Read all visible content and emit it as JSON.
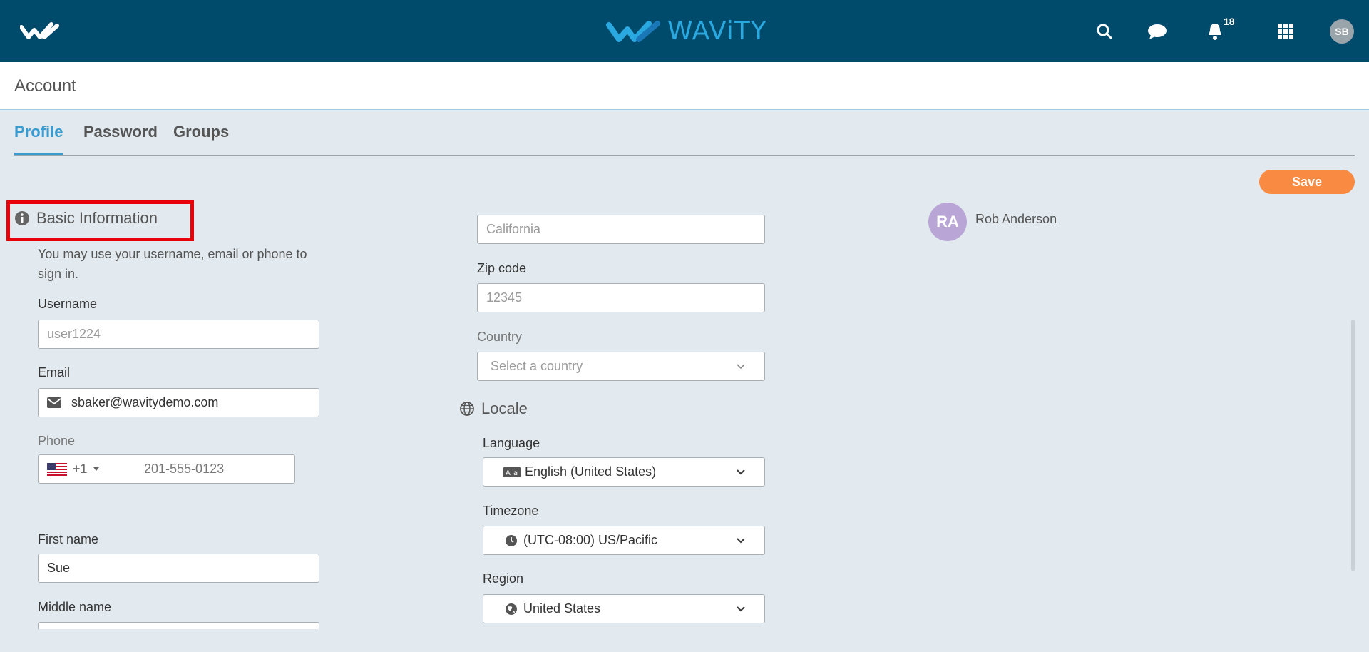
{
  "app": {
    "brand": "WAViTY",
    "notification_count": "18",
    "user_initials": "SB"
  },
  "header": {
    "title": "Account"
  },
  "tabs": [
    {
      "label": "Profile",
      "active": true
    },
    {
      "label": "Password",
      "active": false
    },
    {
      "label": "Groups",
      "active": false
    }
  ],
  "actions": {
    "save_label": "Save"
  },
  "basic_info": {
    "title": "Basic Information",
    "help": "You may use your username, email or phone to sign in.",
    "username_label": "Username",
    "username_placeholder": "user1224",
    "email_label": "Email",
    "email_value": "sbaker@wavitydemo.com",
    "phone_label": "Phone",
    "phone_country_code": "+1",
    "phone_value": "201-555-0123",
    "first_name_label": "First name",
    "first_name_value": "Sue",
    "middle_name_label": "Middle name"
  },
  "address": {
    "state_placeholder": "California",
    "zip_label": "Zip code",
    "zip_placeholder": "12345",
    "country_label": "Country",
    "country_placeholder": "Select a country"
  },
  "locale": {
    "title": "Locale",
    "language_label": "Language",
    "language_value": "English (United States)",
    "timezone_label": "Timezone",
    "timezone_value": "(UTC-08:00) US/Pacific",
    "region_label": "Region",
    "region_value": "United States"
  },
  "owner": {
    "initials": "RA",
    "name": "Rob Anderson"
  },
  "colors": {
    "topbar": "#004a6b",
    "accent": "#3a9bd0",
    "save": "#f98a42",
    "highlight": "#e8000b"
  }
}
